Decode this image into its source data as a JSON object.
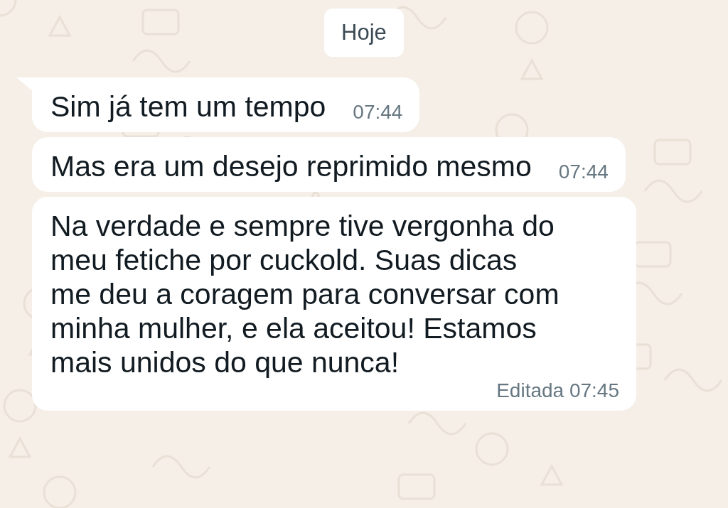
{
  "date_chip": "Hoje",
  "messages": [
    {
      "text": "Sim já tem um tempo",
      "time": "07:44",
      "tail": true
    },
    {
      "text": "Mas era um desejo reprimido mesmo",
      "time": "07:44",
      "tail": false
    },
    {
      "text": "Na verdade e sempre tive vergonha do\nmeu fetiche por cuckold. Suas dicas\nme deu a coragem para conversar com\nminha mulher, e ela aceitou! Estamos\nmais unidos do que nunca!",
      "time": "07:45",
      "edited_label": "Editada",
      "tail": false
    }
  ]
}
